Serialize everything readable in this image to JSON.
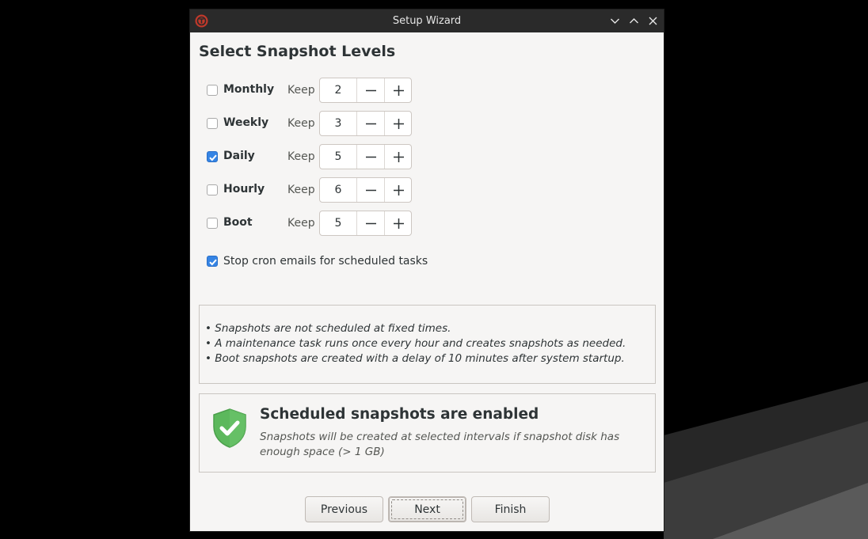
{
  "window": {
    "title": "Setup Wizard",
    "icons": {
      "app": "timeshift-app-icon",
      "minimize": "chevron-down-icon",
      "maximize": "chevron-up-icon",
      "close": "close-icon"
    }
  },
  "page": {
    "heading": "Select Snapshot Levels"
  },
  "levels": [
    {
      "label": "Monthly",
      "checked": false,
      "keep_label": "Keep",
      "value": "2"
    },
    {
      "label": "Weekly",
      "checked": false,
      "keep_label": "Keep",
      "value": "3"
    },
    {
      "label": "Daily",
      "checked": true,
      "keep_label": "Keep",
      "value": "5"
    },
    {
      "label": "Hourly",
      "checked": false,
      "keep_label": "Keep",
      "value": "6"
    },
    {
      "label": "Boot",
      "checked": false,
      "keep_label": "Keep",
      "value": "5"
    }
  ],
  "cron": {
    "label": "Stop cron emails for scheduled tasks",
    "checked": true
  },
  "notes": [
    "• Snapshots are not scheduled at fixed times.",
    "• A maintenance task runs once every hour and creates snapshots as needed.",
    "• Boot snapshots are created with a delay of 10 minutes after system startup."
  ],
  "status": {
    "icon": "shield-check-icon",
    "title": "Scheduled snapshots are enabled",
    "description": "Snapshots will be created at selected intervals if snapshot disk has enough space (> 1 GB)"
  },
  "buttons": {
    "previous": "Previous",
    "next": "Next",
    "finish": "Finish"
  },
  "colors": {
    "accent": "#3584e4",
    "shield": "#5cb85c",
    "titlebar": "#2a2a2a",
    "window_bg": "#f6f5f4"
  }
}
